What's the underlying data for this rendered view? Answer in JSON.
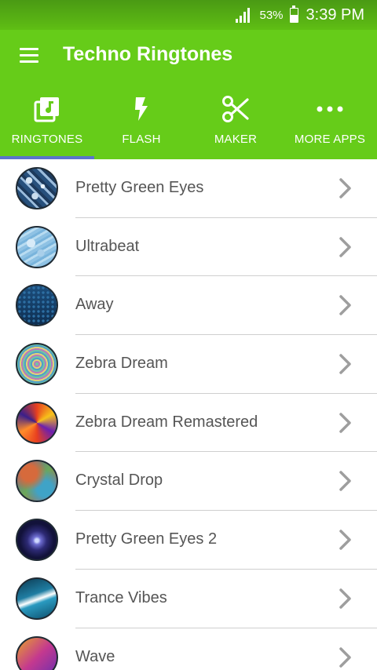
{
  "status_bar": {
    "battery_percent": "53%",
    "battery_level": 0.53,
    "time": "3:39 PM"
  },
  "app_bar": {
    "menu_icon": "hamburger-menu-icon",
    "title": "Techno Ringtones"
  },
  "tabs": [
    {
      "label": "RINGTONES",
      "icon": "music-note-square-icon",
      "selected": true
    },
    {
      "label": "FLASH",
      "icon": "lightning-bolt-icon",
      "selected": false
    },
    {
      "label": "MAKER",
      "icon": "scissors-icon",
      "selected": false
    },
    {
      "label": "MORE APPS",
      "icon": "more-dots-icon",
      "selected": false
    }
  ],
  "colors": {
    "status_bar": "#5fbe14",
    "app_bar": "#66cc19",
    "tab_indicator": "#5b73cc",
    "list_text": "#555555",
    "chevron": "#9e9e9e",
    "divider": "#cfcfcf"
  },
  "ringtones": [
    {
      "title": "Pretty Green Eyes"
    },
    {
      "title": "Ultrabeat"
    },
    {
      "title": "Away"
    },
    {
      "title": "Zebra Dream"
    },
    {
      "title": "Zebra Dream Remastered"
    },
    {
      "title": "Crystal Drop"
    },
    {
      "title": "Pretty Green Eyes 2"
    },
    {
      "title": "Trance Vibes"
    },
    {
      "title": "Wave"
    }
  ]
}
